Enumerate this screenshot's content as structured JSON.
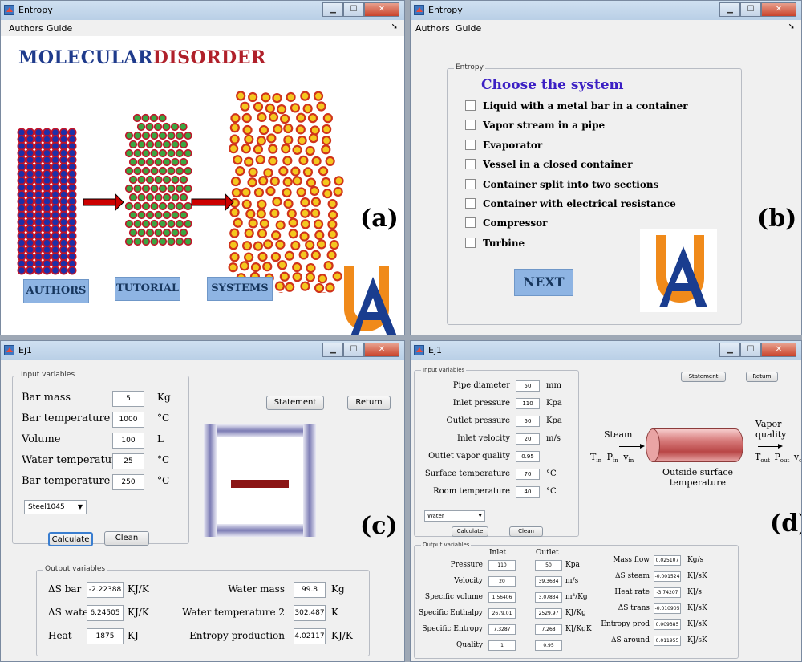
{
  "panels": {
    "a": {
      "title": "Entropy",
      "menu": [
        "Authors",
        "Guide"
      ],
      "heading_blue": "MOLECULAR",
      "heading_red": "DISORDER",
      "buttons": [
        "AUTHORS",
        "TUTORIAL",
        "SYSTEMS"
      ],
      "tag": "(a)"
    },
    "b": {
      "title": "Entropy",
      "menu": [
        "Authors",
        "Guide"
      ],
      "group_title": "Entropy",
      "heading": "Choose the system",
      "options": [
        "Liquid with a metal bar in a container",
        "Vapor stream in a pipe",
        "Evaporator",
        "Vessel in a closed container",
        "Container split into two sections",
        "Container with electrical resistance",
        "Compressor",
        "Turbine"
      ],
      "next": "NEXT",
      "tag": "(b)"
    },
    "c": {
      "title": "Ej1",
      "input_title": "Input variables",
      "inputs": [
        {
          "label": "Bar mass",
          "value": "5",
          "unit": "Kg"
        },
        {
          "label": "Bar temperature",
          "value": "1000",
          "unit": "°C"
        },
        {
          "label": "Volume",
          "value": "100",
          "unit": "L"
        },
        {
          "label": "Water temperature",
          "value": "25",
          "unit": "°C"
        },
        {
          "label": "Bar temperature 2",
          "value": "250",
          "unit": "°C"
        }
      ],
      "material": "Steel1045",
      "calculate": "Calculate",
      "clean": "Clean",
      "statement": "Statement",
      "return": "Return",
      "output_title": "Output variables",
      "outputs_left": [
        {
          "label": "ΔS bar",
          "value": "-2.22388",
          "unit": "KJ/K"
        },
        {
          "label": "ΔS water",
          "value": "6.24505",
          "unit": "KJ/K"
        },
        {
          "label": "Heat",
          "value": "1875",
          "unit": "KJ"
        }
      ],
      "outputs_right": [
        {
          "label": "Water mass",
          "value": "99.8",
          "unit": "Kg"
        },
        {
          "label": "Water temperature 2",
          "value": "302.487",
          "unit": "K"
        },
        {
          "label": "Entropy production",
          "value": "4.02117",
          "unit": "KJ/K"
        }
      ],
      "tag": "(c)"
    },
    "d": {
      "title": "Ej1",
      "input_title": "Input variables",
      "inputs": [
        {
          "label": "Pipe diameter",
          "value": "50",
          "unit": "mm"
        },
        {
          "label": "Inlet pressure",
          "value": "110",
          "unit": "Kpa"
        },
        {
          "label": "Outlet pressure",
          "value": "50",
          "unit": "Kpa"
        },
        {
          "label": "Inlet velocity",
          "value": "20",
          "unit": "m/s"
        },
        {
          "label": "Outlet vapor quality",
          "value": "0.95",
          "unit": ""
        },
        {
          "label": "Surface temperature",
          "value": "70",
          "unit": "°C"
        },
        {
          "label": "Room temperature",
          "value": "40",
          "unit": "°C"
        }
      ],
      "fluid": "Water",
      "calculate": "Calculate",
      "clean": "Clean",
      "statement": "Statement",
      "return": "Return",
      "diagram": {
        "steam": "Steam",
        "vapor_quality_1": "Vapor",
        "vapor_quality_2": "quality",
        "t_in": "T",
        "p_in": "P",
        "v_in": "v",
        "sub_in": "in",
        "t_out": "T",
        "p_out": "P",
        "v_out": "v",
        "sub_out": "out",
        "surface_1": "Outside surface",
        "surface_2": "temperature"
      },
      "output_title": "Output variables",
      "col_inlet": "Inlet",
      "col_outlet": "Outlet",
      "outputs": [
        {
          "label": "Pressure",
          "inlet": "110",
          "outlet": "50",
          "unit": "Kpa"
        },
        {
          "label": "Velocity",
          "inlet": "20",
          "outlet": "39.3634",
          "unit": "m/s"
        },
        {
          "label": "Specific volume",
          "inlet": "1.56406",
          "outlet": "3.07834",
          "unit": "m³/Kg"
        },
        {
          "label": "Specific Enthalpy",
          "inlet": "2679.01",
          "outlet": "2529.97",
          "unit": "KJ/Kg"
        },
        {
          "label": "Specific Entropy",
          "inlet": "7.3287",
          "outlet": "7.268",
          "unit": "KJ/KgK"
        },
        {
          "label": "Quality",
          "inlet": "1",
          "outlet": "0.95",
          "unit": ""
        }
      ],
      "outputs_right": [
        {
          "label": "Mass flow",
          "value": "0.025107",
          "unit": "Kg/s"
        },
        {
          "label": "ΔS steam",
          "value": "-0.001524",
          "unit": "KJ/sK"
        },
        {
          "label": "Heat rate",
          "value": "-3.74207",
          "unit": "KJ/s"
        },
        {
          "label": "ΔS trans",
          "value": "-0.010905",
          "unit": "KJ/sK"
        },
        {
          "label": "Entropy prod",
          "value": "0.009385",
          "unit": "KJ/sK"
        },
        {
          "label": "ΔS around",
          "value": "0.011955",
          "unit": "KJ/sK"
        }
      ],
      "tag": "(d)"
    }
  },
  "colors": {
    "blue_heading": "#1f3b8c",
    "red_heading": "#b0202a",
    "btn_blue": "#8eb4e3",
    "choose_heading": "#3b1fc4",
    "logo_orange": "#f08a1a",
    "logo_blue": "#1a3d8f",
    "bar": "#8b1515"
  }
}
